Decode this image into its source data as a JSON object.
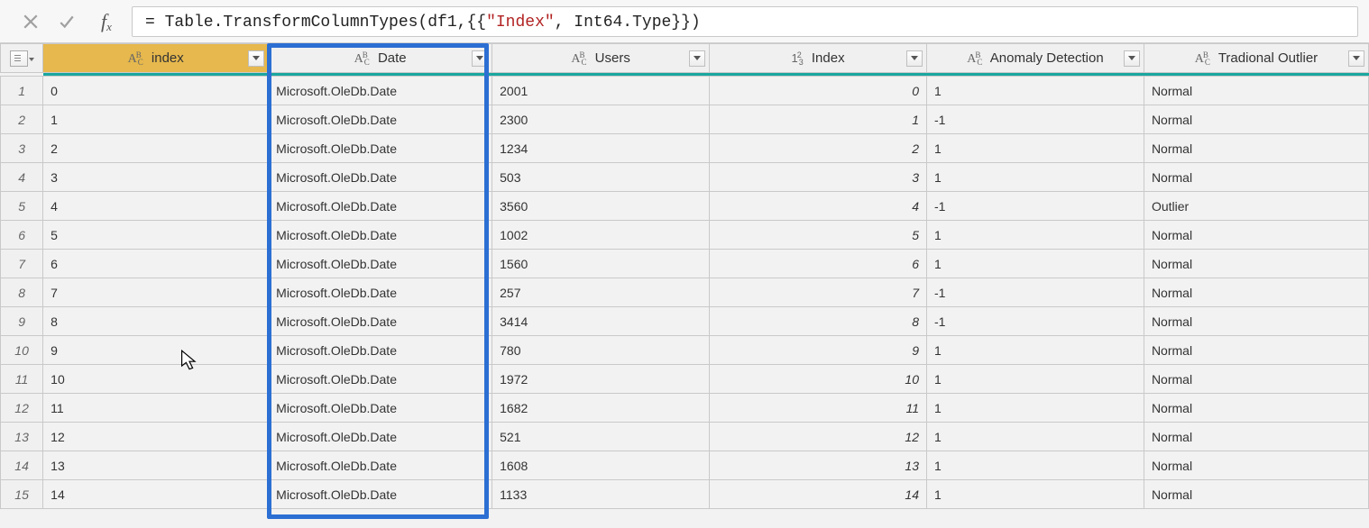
{
  "formula": {
    "prefix": "= Table.TransformColumnTypes(df1,{{",
    "string": "\"Index\"",
    "suffix": ", Int64.Type}})"
  },
  "columns": {
    "index": {
      "label": "index",
      "type": "text"
    },
    "date": {
      "label": "Date",
      "type": "text"
    },
    "users": {
      "label": "Users",
      "type": "text"
    },
    "idx2": {
      "label": "Index",
      "type": "number"
    },
    "anom": {
      "label": "Anomaly Detection",
      "type": "text"
    },
    "trad": {
      "label": "Tradional Outlier",
      "type": "text"
    }
  },
  "rows": [
    {
      "n": "1",
      "index": "0",
      "date": "Microsoft.OleDb.Date",
      "users": "2001",
      "idx2": "0",
      "anom": "1",
      "trad": "Normal"
    },
    {
      "n": "2",
      "index": "1",
      "date": "Microsoft.OleDb.Date",
      "users": "2300",
      "idx2": "1",
      "anom": "-1",
      "trad": "Normal"
    },
    {
      "n": "3",
      "index": "2",
      "date": "Microsoft.OleDb.Date",
      "users": "1234",
      "idx2": "2",
      "anom": "1",
      "trad": "Normal"
    },
    {
      "n": "4",
      "index": "3",
      "date": "Microsoft.OleDb.Date",
      "users": "503",
      "idx2": "3",
      "anom": "1",
      "trad": "Normal"
    },
    {
      "n": "5",
      "index": "4",
      "date": "Microsoft.OleDb.Date",
      "users": "3560",
      "idx2": "4",
      "anom": "-1",
      "trad": "Outlier"
    },
    {
      "n": "6",
      "index": "5",
      "date": "Microsoft.OleDb.Date",
      "users": "1002",
      "idx2": "5",
      "anom": "1",
      "trad": "Normal"
    },
    {
      "n": "7",
      "index": "6",
      "date": "Microsoft.OleDb.Date",
      "users": "1560",
      "idx2": "6",
      "anom": "1",
      "trad": "Normal"
    },
    {
      "n": "8",
      "index": "7",
      "date": "Microsoft.OleDb.Date",
      "users": "257",
      "idx2": "7",
      "anom": "-1",
      "trad": "Normal"
    },
    {
      "n": "9",
      "index": "8",
      "date": "Microsoft.OleDb.Date",
      "users": "3414",
      "idx2": "8",
      "anom": "-1",
      "trad": "Normal"
    },
    {
      "n": "10",
      "index": "9",
      "date": "Microsoft.OleDb.Date",
      "users": "780",
      "idx2": "9",
      "anom": "1",
      "trad": "Normal"
    },
    {
      "n": "11",
      "index": "10",
      "date": "Microsoft.OleDb.Date",
      "users": "1972",
      "idx2": "10",
      "anom": "1",
      "trad": "Normal"
    },
    {
      "n": "12",
      "index": "11",
      "date": "Microsoft.OleDb.Date",
      "users": "1682",
      "idx2": "11",
      "anom": "1",
      "trad": "Normal"
    },
    {
      "n": "13",
      "index": "12",
      "date": "Microsoft.OleDb.Date",
      "users": "521",
      "idx2": "12",
      "anom": "1",
      "trad": "Normal"
    },
    {
      "n": "14",
      "index": "13",
      "date": "Microsoft.OleDb.Date",
      "users": "1608",
      "idx2": "13",
      "anom": "1",
      "trad": "Normal"
    },
    {
      "n": "15",
      "index": "14",
      "date": "Microsoft.OleDb.Date",
      "users": "1133",
      "idx2": "14",
      "anom": "1",
      "trad": "Normal"
    }
  ]
}
